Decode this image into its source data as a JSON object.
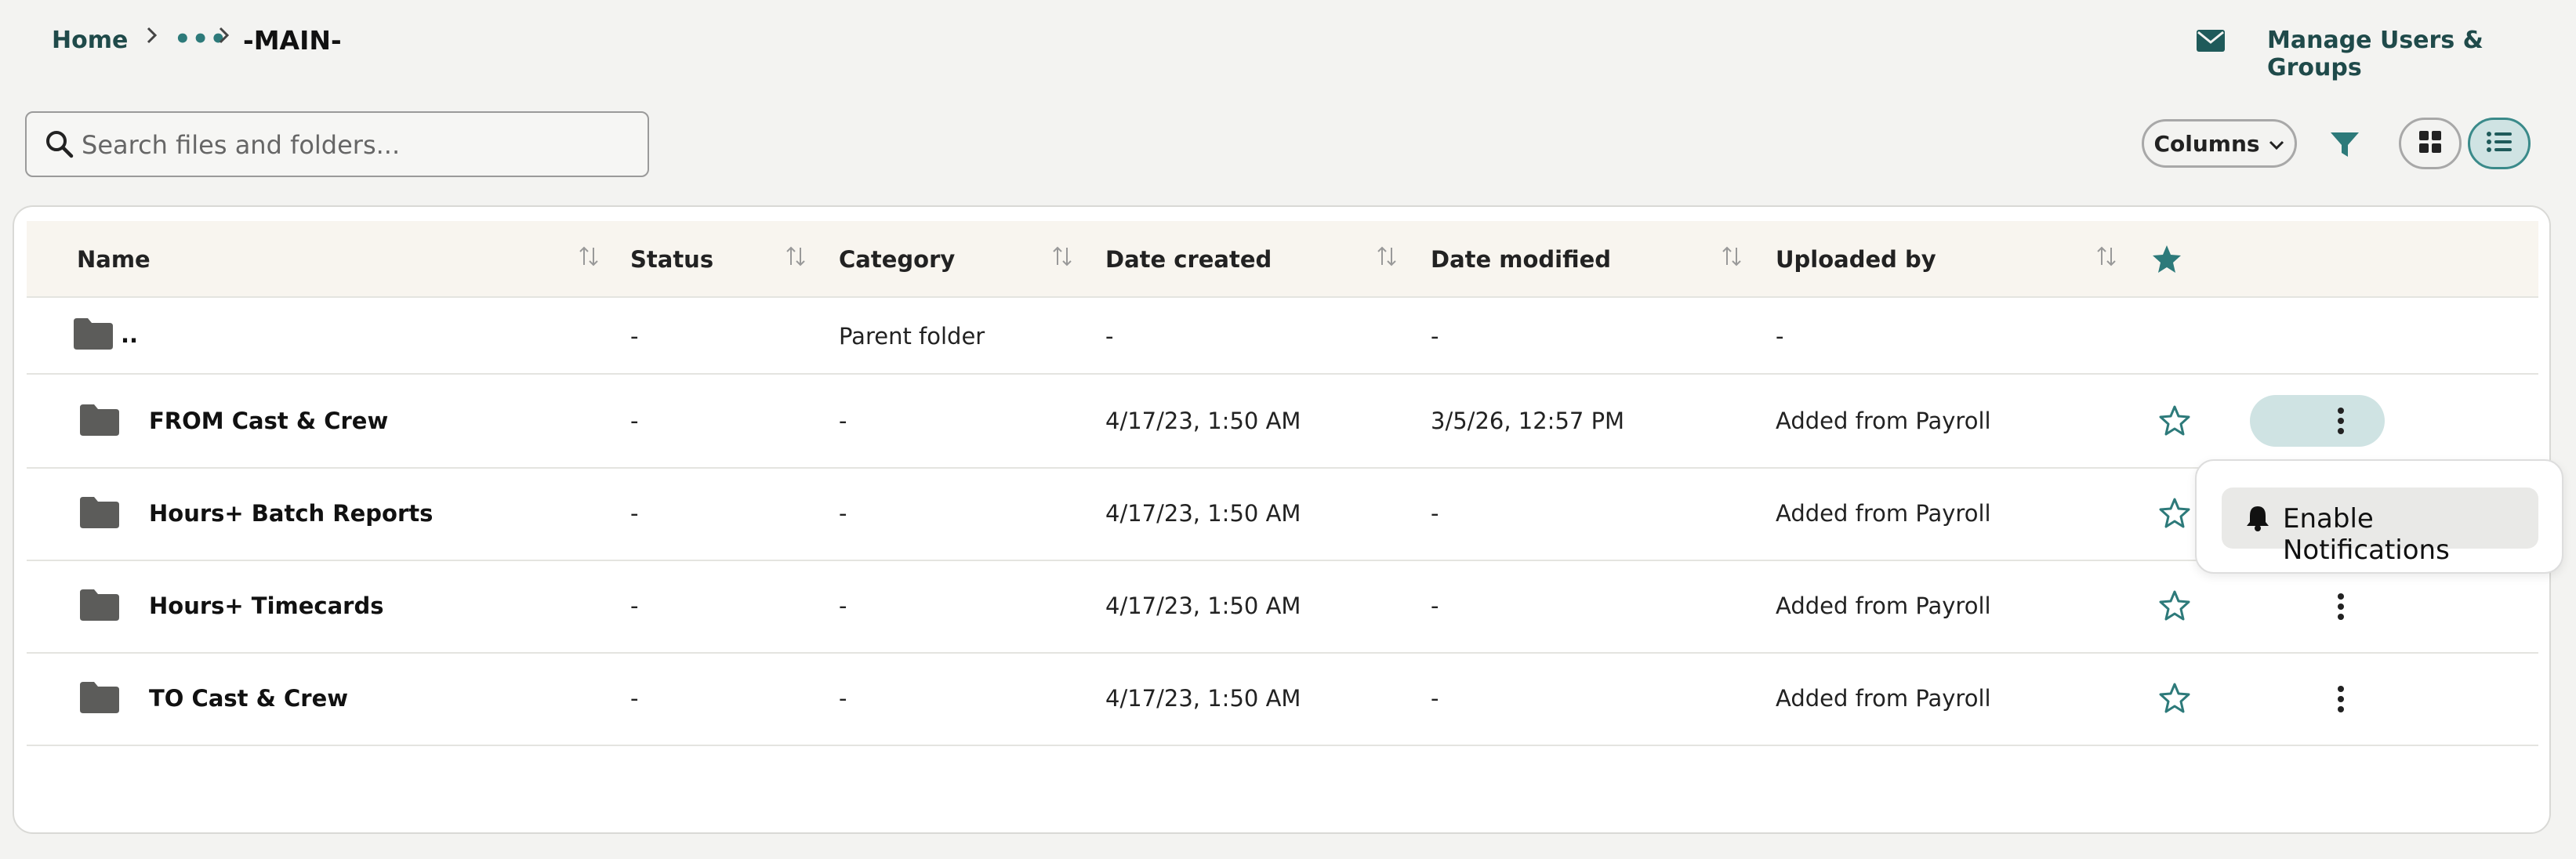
{
  "breadcrumb": {
    "home": "Home",
    "ellipsis": "•••",
    "current": "-MAIN-"
  },
  "header": {
    "manage_link": "Manage Users & Groups",
    "mail_icon": "envelope-icon"
  },
  "search": {
    "placeholder": "Search files and folders...",
    "value": ""
  },
  "toolbar": {
    "columns_label": "Columns",
    "filter_icon": "filter-icon",
    "grid_view_icon": "grid-view-icon",
    "list_view_icon": "list-view-icon",
    "active_view": "list"
  },
  "table": {
    "columns": [
      "Name",
      "Status",
      "Category",
      "Date created",
      "Date modified",
      "Uploaded by"
    ],
    "rows": [
      {
        "name": "..",
        "status": "-",
        "category": "Parent folder",
        "created": "-",
        "modified": "-",
        "uploaded_by": "-"
      },
      {
        "name": "FROM Cast & Crew",
        "status": "-",
        "category": "-",
        "created": "4/17/23, 1:50 AM",
        "modified": "3/5/26, 12:57 PM",
        "uploaded_by": "Added from Payroll"
      },
      {
        "name": "Hours+ Batch Reports",
        "status": "-",
        "category": "-",
        "created": "4/17/23, 1:50 AM",
        "modified": "-",
        "uploaded_by": "Added from Payroll"
      },
      {
        "name": "Hours+ Timecards",
        "status": "-",
        "category": "-",
        "created": "4/17/23, 1:50 AM",
        "modified": "-",
        "uploaded_by": "Added from Payroll"
      },
      {
        "name": "TO Cast & Crew",
        "status": "-",
        "category": "-",
        "created": "4/17/23, 1:50 AM",
        "modified": "-",
        "uploaded_by": "Added from Payroll"
      }
    ]
  },
  "popup": {
    "item_label": "Enable Notifications",
    "icon": "bell-icon"
  },
  "colors": {
    "accent": "#2d7a7a",
    "background": "#f3f3f1",
    "header_bg": "#f8f5ef"
  }
}
